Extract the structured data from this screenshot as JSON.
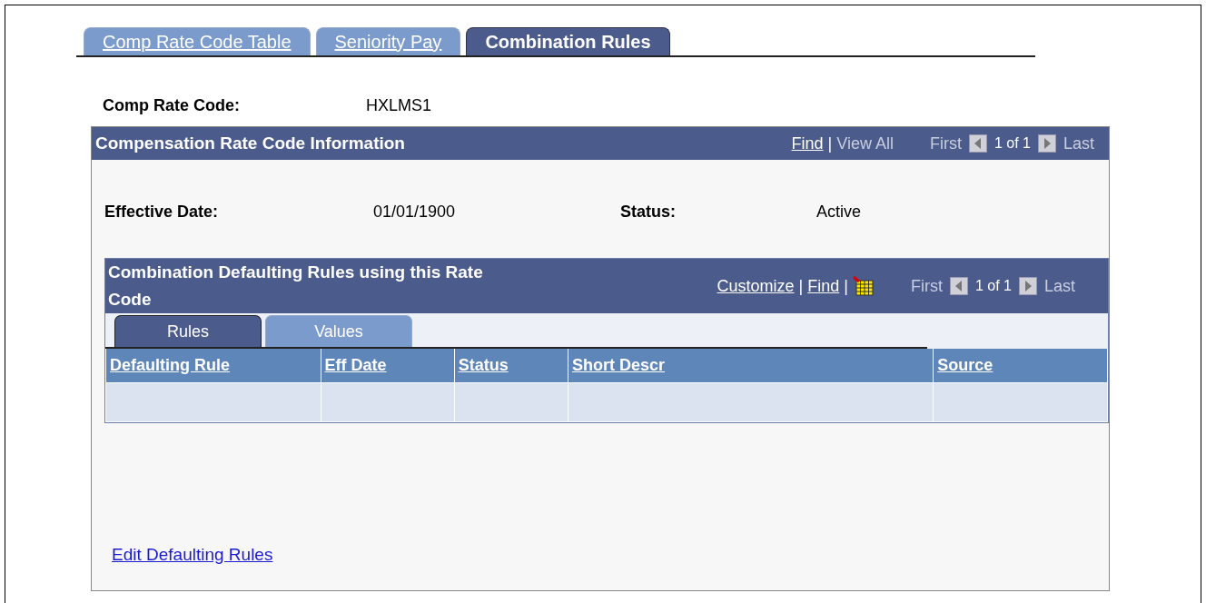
{
  "tabs": [
    {
      "label": "Comp Rate Code Table",
      "selected": false
    },
    {
      "label": "Seniority Pay",
      "selected": false
    },
    {
      "label": "Combination Rules",
      "selected": true
    }
  ],
  "comp_rate_code": {
    "label": "Comp Rate Code:",
    "value": "HXLMS1"
  },
  "info_panel": {
    "title": "Compensation Rate Code Information",
    "nav": {
      "separator": "|",
      "links": [
        {
          "label": "Find",
          "disabled": false
        },
        {
          "label": "View All",
          "disabled": true
        }
      ],
      "first": "First",
      "count": "1 of 1",
      "last": "Last",
      "first_disabled": true,
      "last_disabled": true
    },
    "fields": [
      {
        "label": "Effective Date:",
        "value": "01/01/1900"
      },
      {
        "label": "Status:",
        "value": "Active"
      }
    ],
    "grid": {
      "title": "Combination Defaulting Rules using this Rate Code",
      "nav": {
        "separator": "|",
        "links": [
          {
            "label": "Customize",
            "disabled": false
          },
          {
            "label": "Find",
            "disabled": false
          }
        ],
        "first": "First",
        "count": "1 of 1",
        "last": "Last",
        "first_disabled": true,
        "last_disabled": true
      },
      "tabs": [
        {
          "label": "Rules",
          "selected": true
        },
        {
          "label": "Values",
          "selected": false
        }
      ],
      "columns": [
        "Defaulting Rule",
        "Eff Date",
        "Status",
        "Short Descr",
        "Source"
      ],
      "rows": [
        [
          "",
          "",
          "",
          "",
          ""
        ]
      ]
    },
    "link": "Edit Defaulting Rules"
  }
}
